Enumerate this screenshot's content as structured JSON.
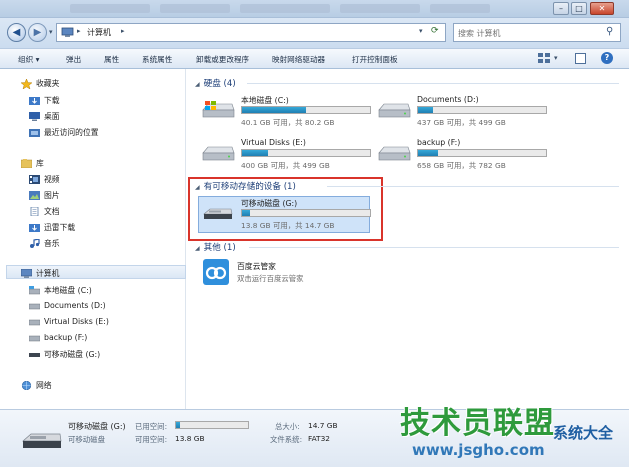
{
  "address": {
    "path": "计算机",
    "search_placeholder": "搜索 计算机"
  },
  "toolbar": {
    "items": [
      "组织 ▾",
      "弹出",
      "属性",
      "系统属性",
      "卸载或更改程序",
      "映射网络驱动器",
      "打开控制面板"
    ]
  },
  "sidebar": {
    "favorites": {
      "label": "收藏夹",
      "items": [
        "下载",
        "桌面",
        "最近访问的位置"
      ]
    },
    "libraries": {
      "label": "库",
      "items": [
        "视频",
        "图片",
        "文档",
        "迅雷下载",
        "音乐"
      ]
    },
    "computer": {
      "label": "计算机",
      "items": [
        "本地磁盘 (C:)",
        "Documents (D:)",
        "Virtual Disks (E:)",
        "backup (F:)",
        "可移动磁盘 (G:)"
      ]
    },
    "network": {
      "label": "网络"
    }
  },
  "main": {
    "hard_disks": {
      "header": "硬盘 (4)",
      "drives": [
        {
          "name": "本地磁盘 (C:)",
          "info": "40.1 GB 可用，共 80.2 GB",
          "used_fraction": 0.5
        },
        {
          "name": "Documents (D:)",
          "info": "437 GB 可用，共 499 GB",
          "used_fraction": 0.12
        },
        {
          "name": "Virtual Disks (E:)",
          "info": "400 GB 可用，共 499 GB",
          "used_fraction": 0.2
        },
        {
          "name": "backup (F:)",
          "info": "658 GB 可用，共 782 GB",
          "used_fraction": 0.16
        }
      ]
    },
    "removable": {
      "header": "有可移动存储的设备 (1)",
      "drives": [
        {
          "name": "可移动磁盘 (G:)",
          "info": "13.8 GB 可用，共 14.7 GB",
          "used_fraction": 0.06
        }
      ]
    },
    "other": {
      "header": "其他 (1)",
      "items": [
        {
          "name": "百度云管家",
          "desc": "双击运行百度云管家"
        }
      ]
    }
  },
  "details": {
    "name": "可移动磁盘 (G:)",
    "type": "可移动磁盘",
    "used_label": "已用空间:",
    "used_fraction": 0.06,
    "free_label": "可用空间:",
    "free_value": "13.8 GB",
    "total_label": "总大小:",
    "total_value": "14.7 GB",
    "fs_label": "文件系统:",
    "fs_value": "FAT32"
  },
  "watermark": {
    "logo": "技术员联盟",
    "url": "www.jsgho.com",
    "sys": "系统大全"
  },
  "colors": {
    "bar_fill": "#1f7fb3",
    "highlight_border": "#d9342b",
    "selected_tile": "#cfe3f9"
  }
}
